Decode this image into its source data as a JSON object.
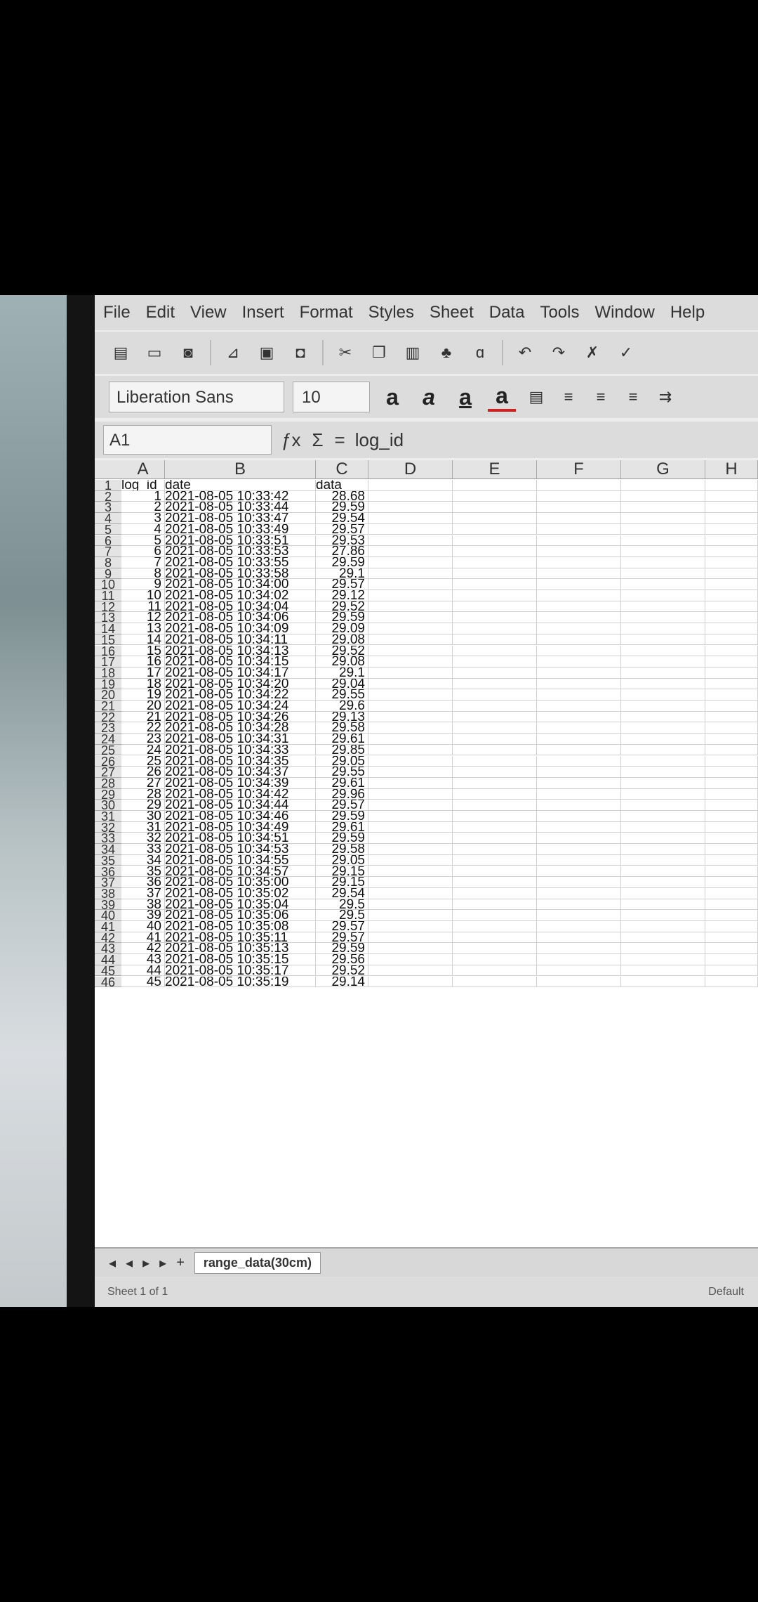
{
  "menu": [
    "File",
    "Edit",
    "View",
    "Insert",
    "Format",
    "Styles",
    "Sheet",
    "Data",
    "Tools",
    "Window",
    "Help"
  ],
  "font": {
    "name": "Liberation Sans",
    "size": "10"
  },
  "formula": {
    "cell": "A1",
    "content": "log_id"
  },
  "columns": [
    "A",
    "B",
    "C",
    "D",
    "E",
    "F",
    "G",
    "H"
  ],
  "headers": {
    "a": "log_id",
    "b": "date",
    "c": "data"
  },
  "rows": [
    {
      "n": "2",
      "id": "1",
      "date": "2021-08-05 10:33:42",
      "val": "28.68"
    },
    {
      "n": "3",
      "id": "2",
      "date": "2021-08-05 10:33:44",
      "val": "29.59"
    },
    {
      "n": "4",
      "id": "3",
      "date": "2021-08-05 10:33:47",
      "val": "29.54"
    },
    {
      "n": "5",
      "id": "4",
      "date": "2021-08-05 10:33:49",
      "val": "29.57"
    },
    {
      "n": "6",
      "id": "5",
      "date": "2021-08-05 10:33:51",
      "val": "29.53"
    },
    {
      "n": "7",
      "id": "6",
      "date": "2021-08-05 10:33:53",
      "val": "27.86"
    },
    {
      "n": "8",
      "id": "7",
      "date": "2021-08-05 10:33:55",
      "val": "29.59"
    },
    {
      "n": "9",
      "id": "8",
      "date": "2021-08-05 10:33:58",
      "val": "29.1"
    },
    {
      "n": "10",
      "id": "9",
      "date": "2021-08-05 10:34:00",
      "val": "29.57"
    },
    {
      "n": "11",
      "id": "10",
      "date": "2021-08-05 10:34:02",
      "val": "29.12"
    },
    {
      "n": "12",
      "id": "11",
      "date": "2021-08-05 10:34:04",
      "val": "29.52"
    },
    {
      "n": "13",
      "id": "12",
      "date": "2021-08-05 10:34:06",
      "val": "29.59"
    },
    {
      "n": "14",
      "id": "13",
      "date": "2021-08-05 10:34:09",
      "val": "29.09"
    },
    {
      "n": "15",
      "id": "14",
      "date": "2021-08-05 10:34:11",
      "val": "29.08"
    },
    {
      "n": "16",
      "id": "15",
      "date": "2021-08-05 10:34:13",
      "val": "29.52"
    },
    {
      "n": "17",
      "id": "16",
      "date": "2021-08-05 10:34:15",
      "val": "29.08"
    },
    {
      "n": "18",
      "id": "17",
      "date": "2021-08-05 10:34:17",
      "val": "29.1"
    },
    {
      "n": "19",
      "id": "18",
      "date": "2021-08-05 10:34:20",
      "val": "29.04"
    },
    {
      "n": "20",
      "id": "19",
      "date": "2021-08-05 10:34:22",
      "val": "29.55"
    },
    {
      "n": "21",
      "id": "20",
      "date": "2021-08-05 10:34:24",
      "val": "29.6"
    },
    {
      "n": "22",
      "id": "21",
      "date": "2021-08-05 10:34:26",
      "val": "29.13"
    },
    {
      "n": "23",
      "id": "22",
      "date": "2021-08-05 10:34:28",
      "val": "29.58"
    },
    {
      "n": "24",
      "id": "23",
      "date": "2021-08-05 10:34:31",
      "val": "29.61"
    },
    {
      "n": "25",
      "id": "24",
      "date": "2021-08-05 10:34:33",
      "val": "29.85"
    },
    {
      "n": "26",
      "id": "25",
      "date": "2021-08-05 10:34:35",
      "val": "29.05"
    },
    {
      "n": "27",
      "id": "26",
      "date": "2021-08-05 10:34:37",
      "val": "29.55"
    },
    {
      "n": "28",
      "id": "27",
      "date": "2021-08-05 10:34:39",
      "val": "29.61"
    },
    {
      "n": "29",
      "id": "28",
      "date": "2021-08-05 10:34:42",
      "val": "29.96"
    },
    {
      "n": "30",
      "id": "29",
      "date": "2021-08-05 10:34:44",
      "val": "29.57"
    },
    {
      "n": "31",
      "id": "30",
      "date": "2021-08-05 10:34:46",
      "val": "29.59"
    },
    {
      "n": "32",
      "id": "31",
      "date": "2021-08-05 10:34:49",
      "val": "29.61"
    },
    {
      "n": "33",
      "id": "32",
      "date": "2021-08-05 10:34:51",
      "val": "29.59"
    },
    {
      "n": "34",
      "id": "33",
      "date": "2021-08-05 10:34:53",
      "val": "29.58"
    },
    {
      "n": "35",
      "id": "34",
      "date": "2021-08-05 10:34:55",
      "val": "29.05"
    },
    {
      "n": "36",
      "id": "35",
      "date": "2021-08-05 10:34:57",
      "val": "29.15"
    },
    {
      "n": "37",
      "id": "36",
      "date": "2021-08-05 10:35:00",
      "val": "29.15"
    },
    {
      "n": "38",
      "id": "37",
      "date": "2021-08-05 10:35:02",
      "val": "29.54"
    },
    {
      "n": "39",
      "id": "38",
      "date": "2021-08-05 10:35:04",
      "val": "29.5"
    },
    {
      "n": "40",
      "id": "39",
      "date": "2021-08-05 10:35:06",
      "val": "29.5"
    },
    {
      "n": "41",
      "id": "40",
      "date": "2021-08-05 10:35:08",
      "val": "29.57"
    },
    {
      "n": "42",
      "id": "41",
      "date": "2021-08-05 10:35:11",
      "val": "29.57"
    },
    {
      "n": "43",
      "id": "42",
      "date": "2021-08-05 10:35:13",
      "val": "29.59"
    },
    {
      "n": "44",
      "id": "43",
      "date": "2021-08-05 10:35:15",
      "val": "29.56"
    },
    {
      "n": "45",
      "id": "44",
      "date": "2021-08-05 10:35:17",
      "val": "29.52"
    },
    {
      "n": "46",
      "id": "45",
      "date": "2021-08-05 10:35:19",
      "val": "29.14"
    }
  ],
  "tabs": {
    "add": "+",
    "sheet": "range_data(30cm)"
  },
  "status": {
    "left": "Sheet 1 of 1",
    "right": "Default"
  }
}
